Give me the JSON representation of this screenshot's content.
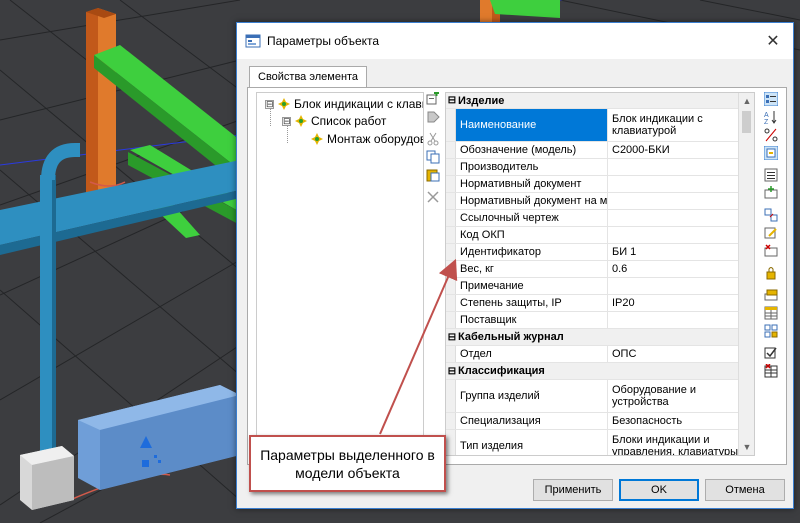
{
  "dialog": {
    "title": "Параметры объекта",
    "close_glyph": "✕",
    "tab_label": "Свойства элемента"
  },
  "tree": {
    "items": [
      {
        "label": "Блок индикации с клавиатурой",
        "expander": "⊟"
      },
      {
        "label": "Список работ",
        "expander": "⊟"
      },
      {
        "label": "Монтаж оборудования",
        "expander": ""
      }
    ]
  },
  "grid": {
    "categories": [
      {
        "label": "Изделие",
        "sign": "⊟"
      },
      {
        "label": "Кабельный журнал",
        "sign": "⊟"
      },
      {
        "label": "Классификация",
        "sign": "⊟"
      }
    ],
    "rows": [
      {
        "name": "Наименование",
        "value": "Блок индикации с клавиатурой"
      },
      {
        "name": "Обозначение (модель)",
        "value": "С2000-БКИ"
      },
      {
        "name": "Производитель",
        "value": ""
      },
      {
        "name": "Нормативный документ",
        "value": ""
      },
      {
        "name": "Нормативный документ на м...",
        "value": ""
      },
      {
        "name": "Ссылочный чертеж",
        "value": ""
      },
      {
        "name": "Код ОКП",
        "value": ""
      },
      {
        "name": "Идентификатор",
        "value": "БИ 1"
      },
      {
        "name": "Вес, кг",
        "value": "0.6"
      },
      {
        "name": "Примечание",
        "value": ""
      },
      {
        "name": "Степень защиты, IP",
        "value": "IP20"
      },
      {
        "name": "Поставщик",
        "value": ""
      },
      {
        "name": "Отдел",
        "value": "ОПС"
      },
      {
        "name": "Группа изделий",
        "value": "Оборудование и устройства"
      },
      {
        "name": "Специализация",
        "value": "Безопасность"
      },
      {
        "name": "Тип изделия",
        "value": "Блоки индикации и управления, клавиатуры"
      }
    ]
  },
  "buttons": {
    "apply": "Применить",
    "ok": "OK",
    "cancel": "Отмена"
  },
  "callout": {
    "text": "Параметры выделенного в модели объекта"
  },
  "colors": {
    "selection": "#0078d7",
    "callout_border": "#c0504d",
    "beam": "#d2691e",
    "green_beam": "#3ecf3e",
    "pipe": "#2e8fc0",
    "device_blue": "#6f9ed8"
  }
}
